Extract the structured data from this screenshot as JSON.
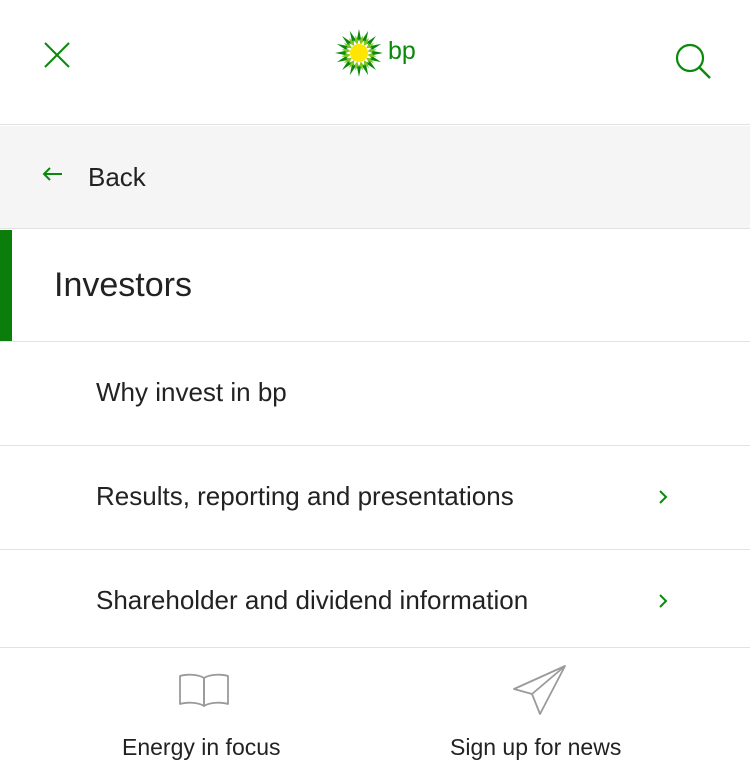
{
  "header": {
    "logo_text": "bp",
    "icons": {
      "close": "close-icon",
      "search": "search-icon",
      "logo": "bp-helios-logo"
    }
  },
  "back": {
    "label": "Back",
    "icon": "arrow-left-icon"
  },
  "section": {
    "title": "Investors"
  },
  "menu": {
    "items": [
      {
        "label": "Why invest in bp",
        "has_submenu": false
      },
      {
        "label": "Results, reporting and presentations",
        "has_submenu": true
      },
      {
        "label": "Shareholder and dividend information",
        "has_submenu": true
      }
    ]
  },
  "bottom": {
    "items": [
      {
        "label": "Energy in focus",
        "icon": "open-book-icon"
      },
      {
        "label": "Sign up for news",
        "icon": "paper-plane-icon"
      }
    ]
  },
  "colors": {
    "accent": "#0a7d0a",
    "logo_green": "#0a8a0a",
    "logo_yellow": "#ffe600",
    "divider": "#e2e2e2",
    "back_bg": "#f5f5f5"
  }
}
